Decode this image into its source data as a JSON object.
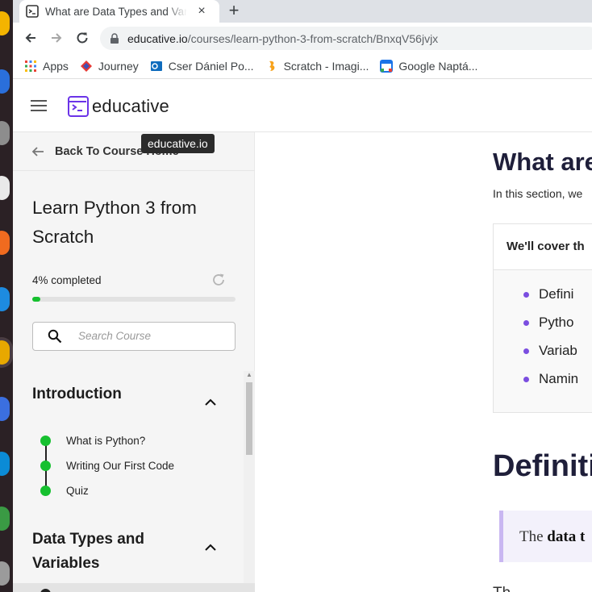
{
  "browser": {
    "tab_title": "What are Data Types and Variables",
    "tab_close": "×",
    "new_tab": "+",
    "url_host": "educative.io",
    "url_path": "/courses/learn-python-3-from-scratch/BnxqV56jvjx",
    "bookmarks": [
      {
        "label": "Apps",
        "icon": "apps-grid-icon",
        "color": "#e8453c"
      },
      {
        "label": "Journey",
        "icon": "journey-icon",
        "color": "#e53935"
      },
      {
        "label": "Cser Dániel Po...",
        "icon": "outlook-icon",
        "color": "#0f6cbd"
      },
      {
        "label": "Scratch - Imagi...",
        "icon": "scratch-icon",
        "color": "#f7a21b"
      },
      {
        "label": "Google Naptá...",
        "icon": "google-calendar-icon",
        "color": "#1a73e8"
      }
    ]
  },
  "header": {
    "logo_text": "educative",
    "brand_color": "#6b34e8"
  },
  "tooltip": "educative.io",
  "sidebar": {
    "back_label": "Back To Course Home",
    "course_title": "Learn Python 3 from Scratch",
    "progress_label": "4% completed",
    "progress_value": 0.04,
    "search_placeholder": "Search Course",
    "sections": [
      {
        "title": "Introduction",
        "lessons": [
          "What is Python?",
          "Writing Our First Code",
          "Quiz"
        ]
      },
      {
        "title": "Data Types and Variables",
        "lessons": []
      }
    ]
  },
  "content": {
    "title": "What are",
    "intro": "In this section, we",
    "cover_heading": "We'll cover th",
    "cover_items": [
      "Defini",
      "Pytho",
      "Variab",
      "Namin"
    ],
    "h2": "Definiti",
    "quote_prefix": "The",
    "quote_bold": "data t",
    "peek": "Th"
  }
}
